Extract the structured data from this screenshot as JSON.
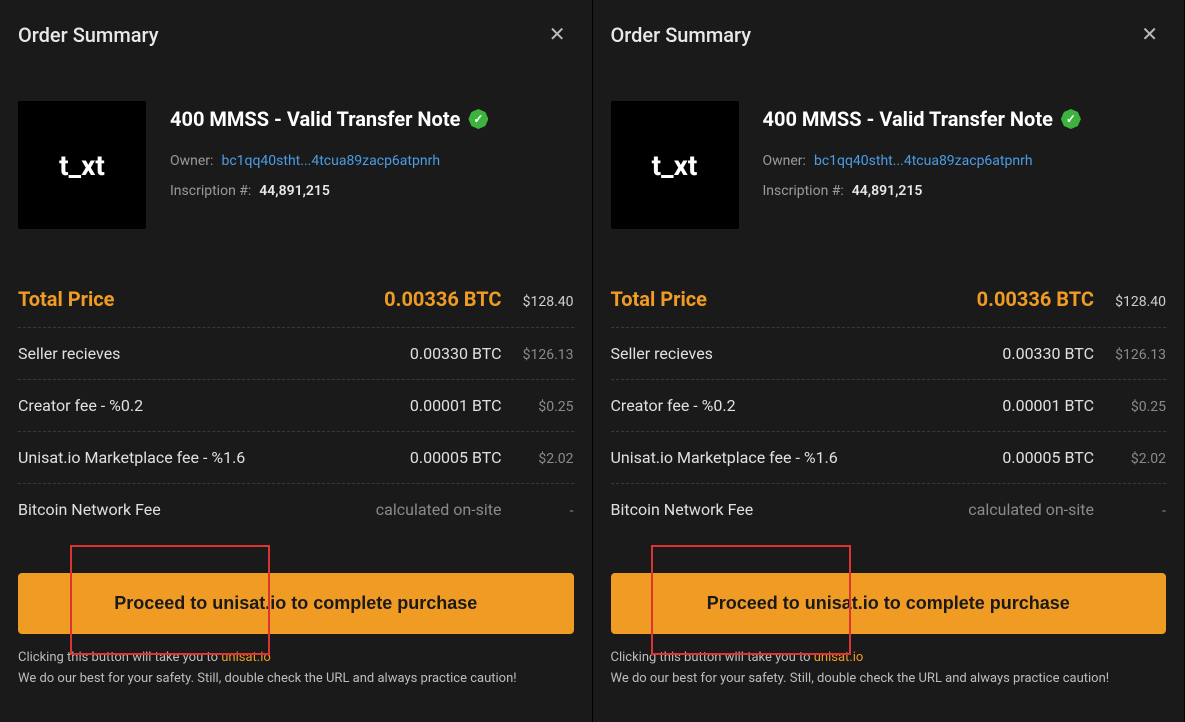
{
  "panels": [
    {
      "title": "Order Summary",
      "thumb_text": "t_xt",
      "item_title": "400 MMSS - Valid Transfer Note",
      "owner_label": "Owner:",
      "owner_address": "bc1qq40stht...4tcua89zacp6atpnrh",
      "inscription_label": "Inscription #:",
      "inscription_number": "44,891,215",
      "lines": [
        {
          "label": "Total Price",
          "btc": "0.00336 BTC",
          "usd": "$128.40",
          "total": true
        },
        {
          "label": "Seller recieves",
          "btc": "0.00330 BTC",
          "usd": "$126.13"
        },
        {
          "label": "Creator fee - %0.2",
          "btc": "0.00001 BTC",
          "usd": "$0.25"
        },
        {
          "label": "Unisat.io Marketplace fee - %1.6",
          "btc": "0.00005 BTC",
          "usd": "$2.02"
        },
        {
          "label": "Bitcoin Network Fee",
          "btc": "calculated on-site",
          "usd": "-"
        }
      ],
      "cta": "Proceed to unisat.io to complete purchase",
      "footer_prefix": "Clicking this button will take you to ",
      "footer_link": "unisat.io",
      "footer_line2": "We do our best for your safety. Still, double check the URL and always practice caution!"
    },
    {
      "title": "Order Summary",
      "thumb_text": "t_xt",
      "item_title": "400 MMSS - Valid Transfer Note",
      "owner_label": "Owner:",
      "owner_address": "bc1qq40stht...4tcua89zacp6atpnrh",
      "inscription_label": "Inscription #:",
      "inscription_number": "44,891,215",
      "lines": [
        {
          "label": "Total Price",
          "btc": "0.00336 BTC",
          "usd": "$128.40",
          "total": true
        },
        {
          "label": "Seller recieves",
          "btc": "0.00330 BTC",
          "usd": "$126.13"
        },
        {
          "label": "Creator fee - %0.2",
          "btc": "0.00001 BTC",
          "usd": "$0.25"
        },
        {
          "label": "Unisat.io Marketplace fee - %1.6",
          "btc": "0.00005 BTC",
          "usd": "$2.02"
        },
        {
          "label": "Bitcoin Network Fee",
          "btc": "calculated on-site",
          "usd": "-"
        }
      ],
      "cta": "Proceed to unisat.io to complete purchase",
      "footer_prefix": "Clicking this button will take you to ",
      "footer_link": "unisat.io",
      "footer_line2": "We do our best for your safety. Still, double check the URL and always practice caution!"
    }
  ]
}
